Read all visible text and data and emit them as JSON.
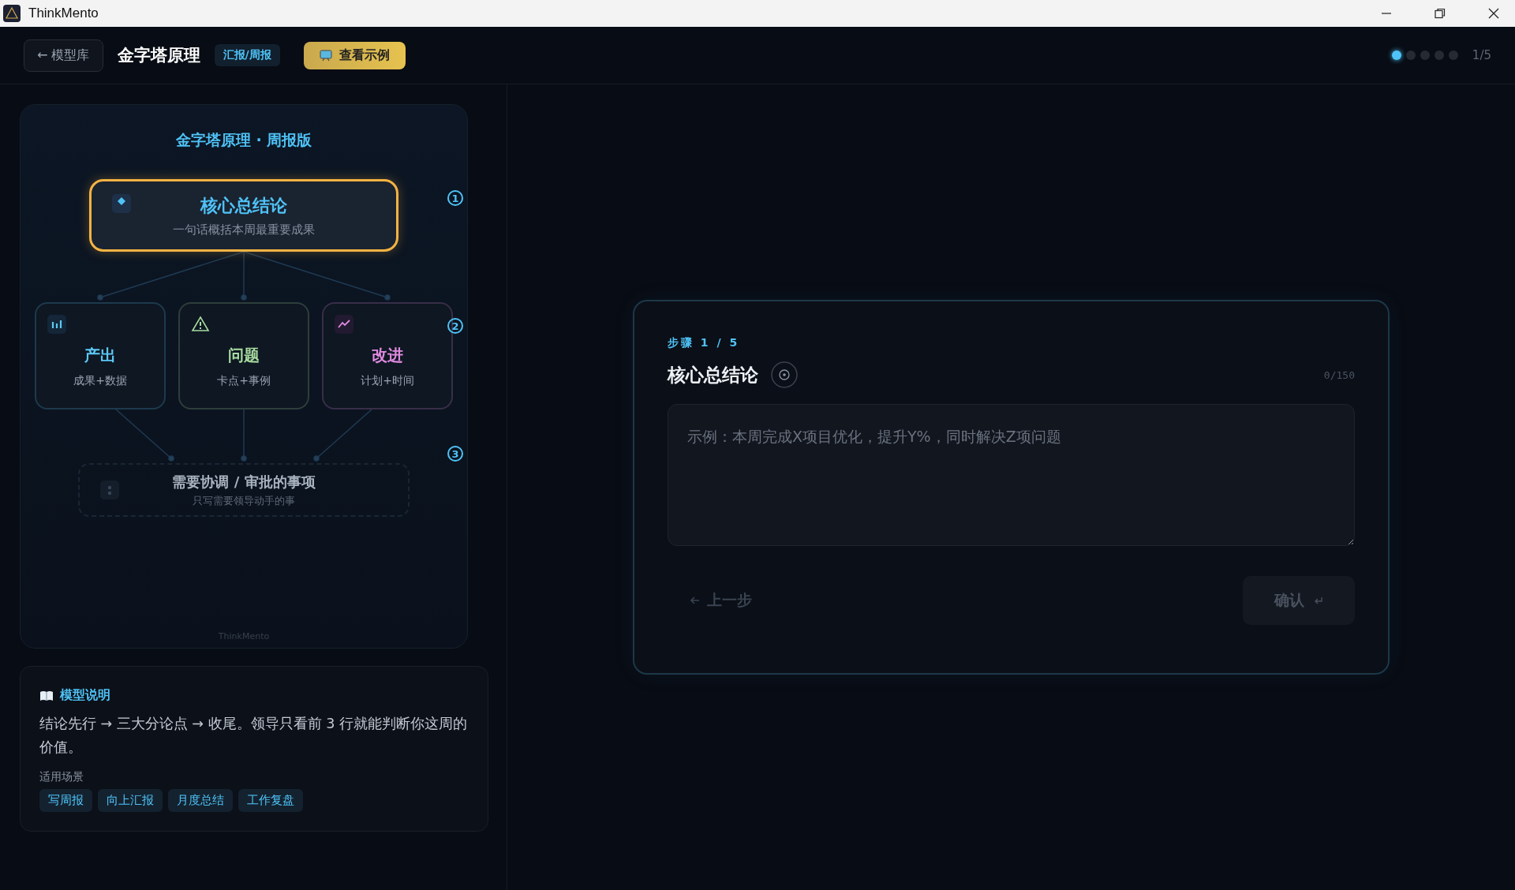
{
  "window": {
    "title": "ThinkMento"
  },
  "header": {
    "back_button": "← 模型库",
    "title": "金字塔原理",
    "tag": "汇报/周报",
    "example_button": "查看示例",
    "progress": [
      {
        "selected": true
      },
      {
        "selected": false
      },
      {
        "selected": false
      },
      {
        "selected": false
      },
      {
        "selected": false
      }
    ],
    "counter": "1/5"
  },
  "diagram": {
    "title": "金字塔原理 · 周报版",
    "top_node": {
      "title": "核心总结论",
      "subtitle": "一句话概括本周最重要成果"
    },
    "middle_nodes": [
      {
        "kind": "chart",
        "title": "产出",
        "subtitle": "成果+数据",
        "color": "#5cc8f5"
      },
      {
        "kind": "warning",
        "title": "问题",
        "subtitle": "卡点+事例",
        "color": "#a8dba0"
      },
      {
        "kind": "trend",
        "title": "改进",
        "subtitle": "计划+时间",
        "color": "#e08ae0"
      }
    ],
    "bottom_node": {
      "title": "需要协调 / 审批的事项",
      "subtitle": "只写需要领导动手的事"
    },
    "step_markers": [
      "1",
      "2",
      "3"
    ],
    "footer": "ThinkMento"
  },
  "description": {
    "title": "模型说明",
    "text": "结论先行 → 三大分论点 → 收尾。领导只看前 3 行就能判断你这周的价值。",
    "scenarios_label": "适用场景",
    "tags": [
      "写周报",
      "向上汇报",
      "月度总结",
      "工作复盘"
    ]
  },
  "step_card": {
    "step_label": "步骤 1 / 5",
    "title": "核心总结论",
    "char_count": "0/150",
    "placeholder": "示例：本周完成X项目优化，提升Y%，同时解决Z项问题",
    "back_button": {
      "label": "上一步",
      "disabled": true
    },
    "confirm_button": {
      "label": "确认",
      "disabled": true
    }
  }
}
